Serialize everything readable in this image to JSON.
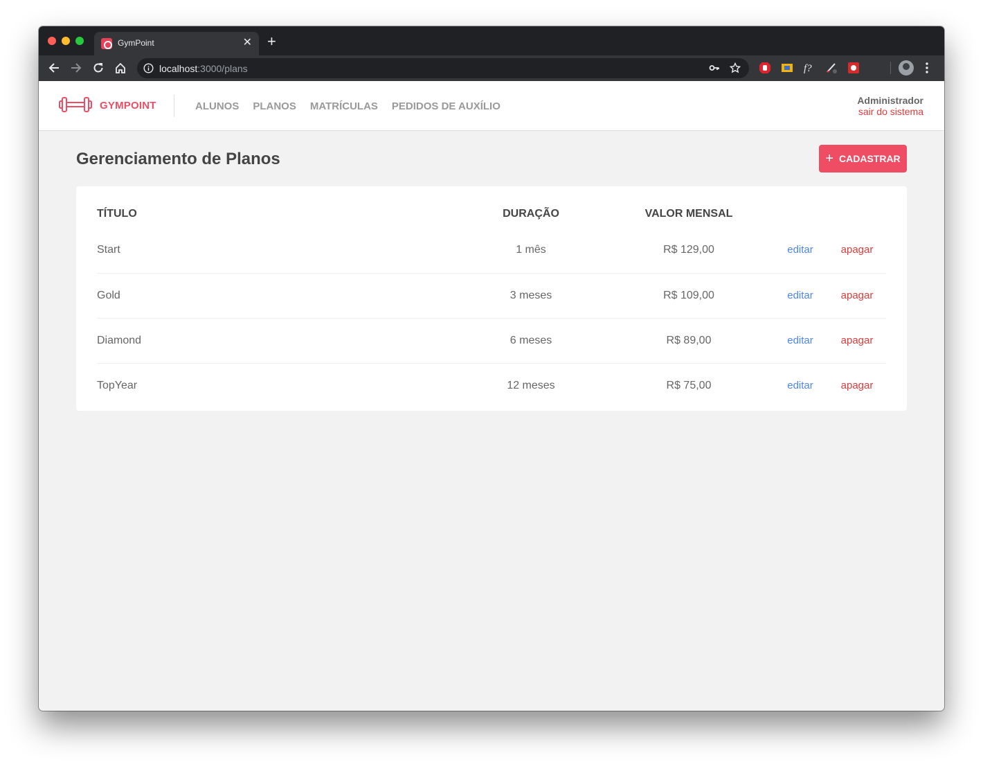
{
  "browser": {
    "tab_title": "GymPoint",
    "url_host": "localhost",
    "url_path": ":3000/plans"
  },
  "header": {
    "brand": "GYMPOINT",
    "nav": [
      {
        "label": "ALUNOS"
      },
      {
        "label": "PLANOS"
      },
      {
        "label": "MATRÍCULAS"
      },
      {
        "label": "PEDIDOS DE AUXÍLIO"
      }
    ],
    "user_name": "Administrador",
    "logout_label": "sair do sistema"
  },
  "page": {
    "title": "Gerenciamento de Planos",
    "register_label": "CADASTRAR"
  },
  "table": {
    "headers": {
      "title": "TÍTULO",
      "duration": "DURAÇÃO",
      "monthly_value": "VALOR MENSAL"
    },
    "rows": [
      {
        "title": "Start",
        "duration": "1 mês",
        "value": "R$ 129,00",
        "edit": "editar",
        "delete": "apagar"
      },
      {
        "title": "Gold",
        "duration": "3 meses",
        "value": "R$ 109,00",
        "edit": "editar",
        "delete": "apagar"
      },
      {
        "title": "Diamond",
        "duration": "6 meses",
        "value": "R$ 89,00",
        "edit": "editar",
        "delete": "apagar"
      },
      {
        "title": "TopYear",
        "duration": "12 meses",
        "value": "R$ 75,00",
        "edit": "editar",
        "delete": "apagar"
      }
    ]
  },
  "colors": {
    "brand": "#ee4d64",
    "edit_link": "#4d85ee",
    "delete_link": "#de3b3b",
    "background": "#f2f2f2"
  }
}
